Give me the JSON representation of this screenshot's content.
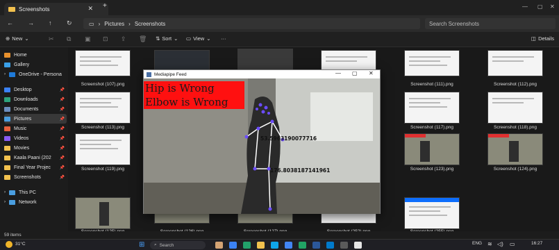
{
  "tab": {
    "title": "Screenshots"
  },
  "address": {
    "path1": "Pictures",
    "path2": "Screenshots",
    "search_placeholder": "Search Screenshots"
  },
  "commands": {
    "new": "New",
    "sort": "Sort",
    "view": "View",
    "more": "···",
    "details": "Details"
  },
  "sidebar": {
    "items": [
      {
        "label": "Home",
        "color": "#e8912d"
      },
      {
        "label": "Gallery",
        "color": "#3aa0e8"
      },
      {
        "label": "OneDrive - Persona",
        "color": "#1f7ad8"
      },
      {
        "label": "Desktop",
        "color": "#3b82f6"
      },
      {
        "label": "Downloads",
        "color": "#2ea37c"
      },
      {
        "label": "Documents",
        "color": "#6c8ebf"
      },
      {
        "label": "Pictures",
        "color": "#4a9ee0"
      },
      {
        "label": "Music",
        "color": "#e8613d"
      },
      {
        "label": "Videos",
        "color": "#8b5cf6"
      },
      {
        "label": "Movies",
        "color": "#f2c14e"
      },
      {
        "label": "Kaala Paani (202",
        "color": "#f2c14e"
      },
      {
        "label": "Final Year Projec",
        "color": "#f2c14e"
      },
      {
        "label": "Screenshots",
        "color": "#f2c14e"
      },
      {
        "label": "This PC",
        "color": "#4a9ee0"
      },
      {
        "label": "Network",
        "color": "#4a9ee0"
      }
    ]
  },
  "thumbs": [
    {
      "label": "Screenshot (107).png"
    },
    {
      "label": "Screenshot (111).png"
    },
    {
      "label": "Screenshot (112).png"
    },
    {
      "label": "Screenshot (113).png"
    },
    {
      "label": "Screenshot (117).png"
    },
    {
      "label": "Screenshot (118).png"
    },
    {
      "label": "Screenshot (119).png"
    },
    {
      "label": "Screenshot (123).png"
    },
    {
      "label": "Screenshot (124).png"
    },
    {
      "label": "Screenshot (125).png"
    },
    {
      "label": "Screenshot (126).png"
    },
    {
      "label": "Screenshot (127).png"
    },
    {
      "label": "Screenshot (252).png"
    },
    {
      "label": "Screenshot (255).png"
    }
  ],
  "status": {
    "count": "59 items"
  },
  "mediapipe": {
    "title": "Mediapipe Feed",
    "banner1": "Hip is Wrong",
    "banner2": "Elbow is Wrong",
    "angle1": "53.5963190077716",
    "angle2": "176.8038187141961"
  },
  "taskbar": {
    "weather": "31°C",
    "search": "Search",
    "lang": "ENG",
    "time": "16:27"
  }
}
